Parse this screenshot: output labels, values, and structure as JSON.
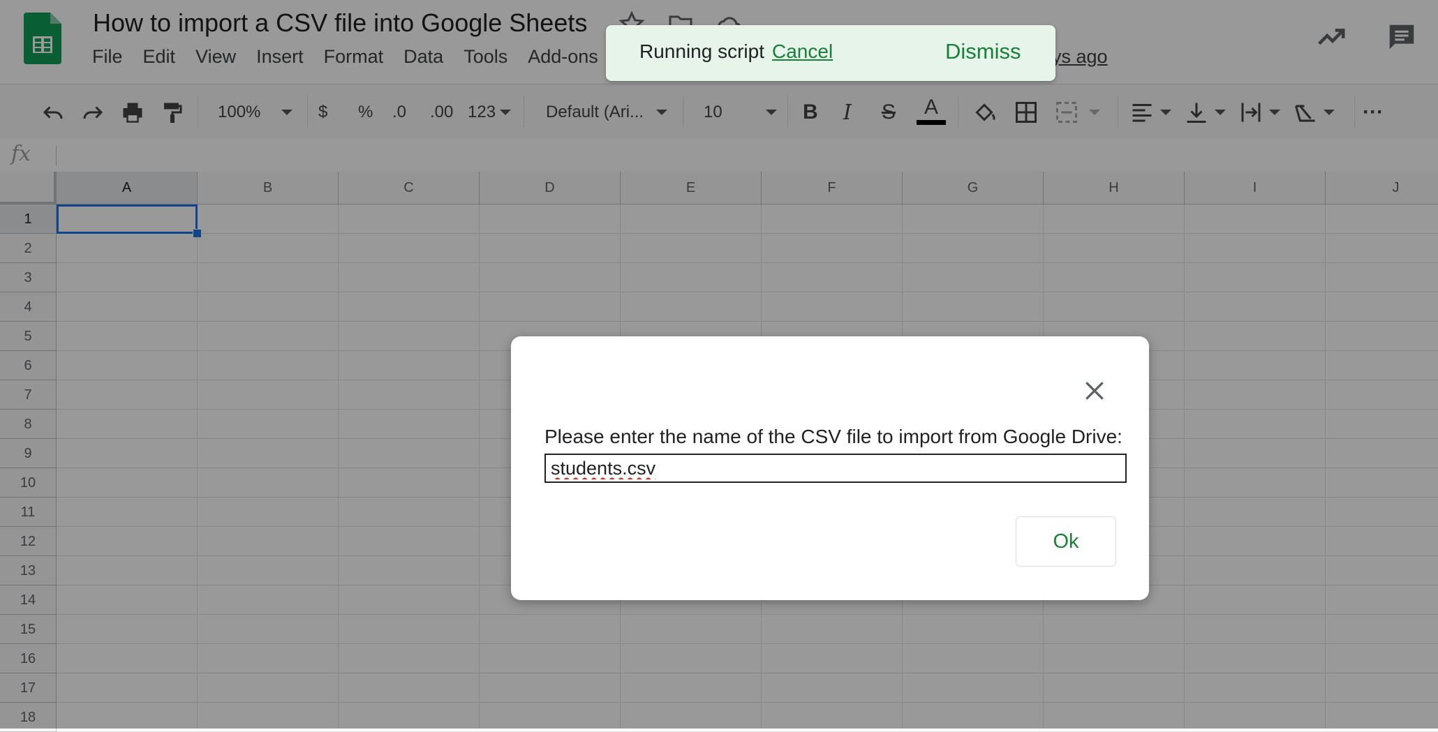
{
  "doc": {
    "title": "How to import a CSV file into Google Sheets",
    "last_edit": "ays ago"
  },
  "menu": [
    "File",
    "Edit",
    "View",
    "Insert",
    "Format",
    "Data",
    "Tools",
    "Add-ons"
  ],
  "toolbar": {
    "zoom": "100%",
    "currency": "$",
    "percent": "%",
    "dec_decrease": ".0",
    "dec_increase": ".00",
    "more_formats": "123",
    "font": "Default (Ari...",
    "font_size": "10",
    "bold": "B",
    "italic": "I",
    "strike": "S",
    "text_color": "A",
    "more": "···"
  },
  "formula_bar": {
    "fx": "fx"
  },
  "grid": {
    "columns": [
      "A",
      "B",
      "C",
      "D",
      "E",
      "F",
      "G",
      "H",
      "I",
      "J"
    ],
    "rows": [
      "1",
      "2",
      "3",
      "4",
      "5",
      "6",
      "7",
      "8",
      "9",
      "10",
      "11",
      "12",
      "13",
      "14",
      "15",
      "16",
      "17",
      "18"
    ],
    "active_cell": "A1"
  },
  "butterbar": {
    "message": "Running script",
    "cancel": "Cancel",
    "dismiss": "Dismiss"
  },
  "dialog": {
    "prompt": "Please enter the name of the CSV file to import from Google Drive:",
    "input_value": "students.csv",
    "ok_label": "Ok"
  },
  "colors": {
    "sheets_green": "#0f9d58",
    "selection_blue": "#1a73e8",
    "action_green": "#188038",
    "butterbar_bg": "#e6f4ea"
  }
}
